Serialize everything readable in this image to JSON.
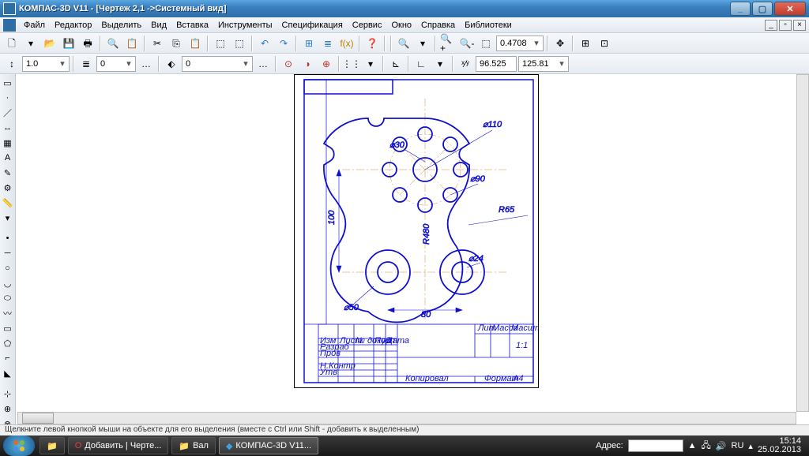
{
  "title": "КОМПАС-3D V11 - [Чертеж 2,1 ->Системный вид]",
  "menu": {
    "items": [
      "Файл",
      "Редактор",
      "Выделить",
      "Вид",
      "Вставка",
      "Инструменты",
      "Спецификация",
      "Сервис",
      "Окно",
      "Справка",
      "Библиотеки"
    ]
  },
  "toolbar1": {
    "zoom_value": "0.4708"
  },
  "toolbar2": {
    "field1": "1.0",
    "field2": "0",
    "field3": "0",
    "coord_x": "96.525",
    "coord_y": "125.81"
  },
  "drawing": {
    "dim_d30": "⌀30",
    "dim_d110": "⌀110",
    "dim_d90": "⌀90",
    "dim_r65": "R65",
    "dim_r480": "R480",
    "dim_100": "100",
    "dim_80": "80",
    "dim_d50": "⌀50",
    "dim_d24": "⌀24",
    "tb_lit": "Лит",
    "tb_mass": "Масса",
    "tb_scale": "Масштаб",
    "tb_11": "1:1",
    "tb_razrab": "Разраб",
    "tb_check": "Пров",
    "tb_kontrol": "Н.Контр",
    "tb_util": "Утв",
    "tb_izm": "Изм",
    "tb_list": "Лист",
    "tb_nodok": "№ докум",
    "tb_sign": "Подп",
    "tb_date": "Дата",
    "tb_kop": "Копировал",
    "tb_fmt": "Формат",
    "tb_a4": "A4"
  },
  "status": "Щелкните левой кнопкой мыши на объекте для его выделения (вместе с Ctrl или Shift - добавить к выделенным)",
  "taskbar": {
    "tasks": [
      {
        "label": "Добавить | Черте..."
      },
      {
        "label": "Вал"
      },
      {
        "label": "КОМПАС-3D V11..."
      }
    ],
    "addr_label": "Адрес:",
    "lang": "RU",
    "time": "15:14",
    "date": "25.02.2013"
  }
}
